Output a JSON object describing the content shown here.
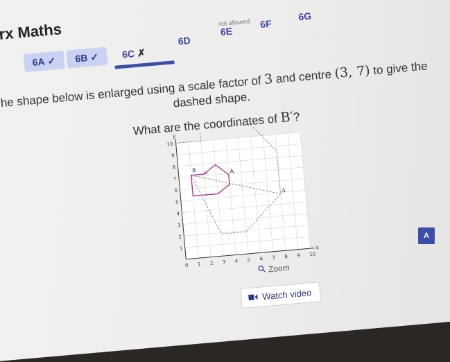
{
  "brand": {
    "name": "barx Maths"
  },
  "tabs": [
    {
      "label": "6A",
      "status": "✓"
    },
    {
      "label": "6B",
      "status": "✓"
    },
    {
      "label": "6C",
      "status": "✗"
    },
    {
      "label": "6D",
      "status": ""
    },
    {
      "label": "6E",
      "status": ""
    },
    {
      "label": "6F",
      "status": ""
    },
    {
      "label": "6G",
      "status": ""
    }
  ],
  "calculator_note": "not allowed",
  "question": {
    "text_before": "The shape below is enlarged using a scale factor of ",
    "scale_factor": "3",
    "text_middle": " and centre ",
    "centre": "(3, 7)",
    "text_after": " to give the dashed shape.",
    "ask_before": "What are the coordinates of ",
    "point": "B′",
    "ask_after": "?"
  },
  "graph": {
    "y_axis_label": "y",
    "x_axis_label": "x",
    "x_ticks": [
      "0",
      "1",
      "2",
      "3",
      "4",
      "5",
      "6",
      "7",
      "8",
      "9",
      "10"
    ],
    "y_ticks": [
      "1",
      "2",
      "3",
      "4",
      "5",
      "6",
      "7",
      "8",
      "9",
      "10"
    ],
    "labels": {
      "B": "B",
      "A": "A",
      "A_prime": "A′"
    }
  },
  "buttons": {
    "zoom": "Zoom",
    "watch_video": "Watch video"
  },
  "side_badge": "A",
  "colors": {
    "accent": "#3c4fa8",
    "shape": "#b0359a",
    "dashed": "#888888"
  }
}
